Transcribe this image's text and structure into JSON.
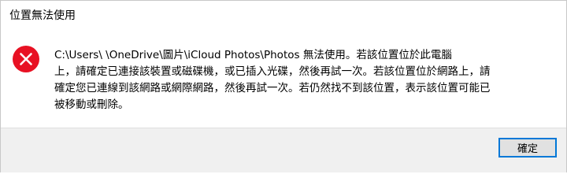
{
  "dialog": {
    "title": "位置無法使用",
    "icon": "error-icon",
    "icon_color": "#e81123",
    "message_lines": [
      "C:\\Users\\           \\OneDrive\\圖片\\iCloud Photos\\Photos 無法使用。若該位置位於此電腦",
      "上，請確定已連接該裝置或磁碟機，或已插入光碟，然後再試一次。若該位置位於網路上，請",
      "確定您已連線到該網路或網際網路，然後再試一次。若仍然找不到該位置，表示該位置可能已",
      "被移動或刪除。"
    ],
    "ok_label": "確定",
    "accent_color": "#0078d7"
  }
}
